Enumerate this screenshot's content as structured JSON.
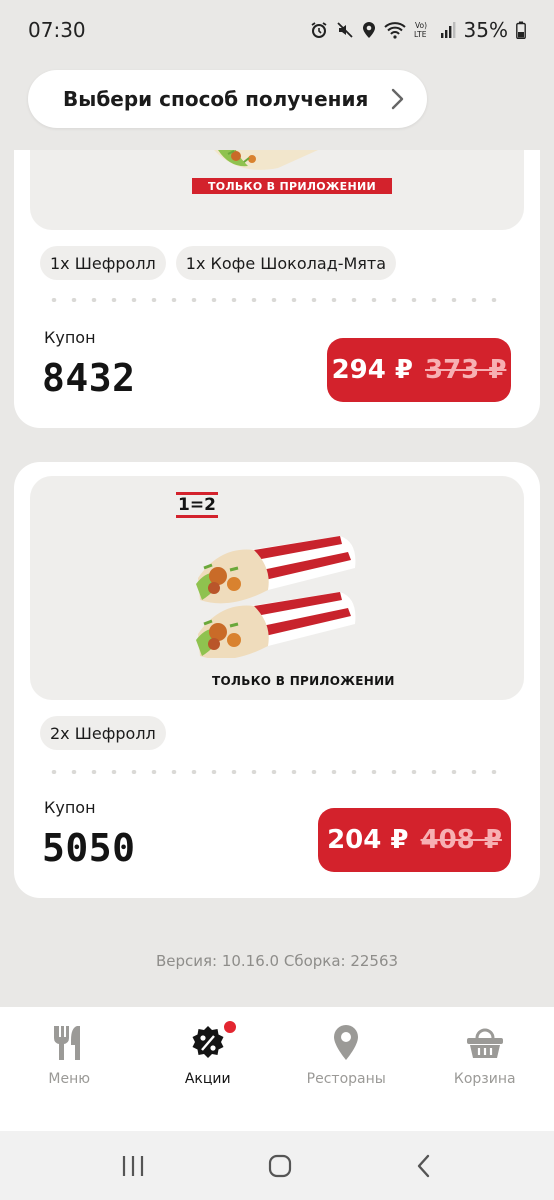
{
  "status_bar": {
    "time": "07:30",
    "battery": "35%",
    "icons": [
      "alarm-icon",
      "mute-icon",
      "location-icon",
      "wifi-icon",
      "volte-icon",
      "signal-icon",
      "battery-icon"
    ]
  },
  "delivery": {
    "label": "Выбери способ получения"
  },
  "offers": [
    {
      "promo_text": "ТОЛЬКО В ПРИЛОЖЕНИИ",
      "items": [
        "1х Шефролл",
        "1х Кофе Шоколад-Мята"
      ],
      "coupon_label": "Купон",
      "coupon_code": "8432",
      "price": "294 ₽",
      "old_price": "373 ₽"
    },
    {
      "badge": "1=2",
      "promo_text": "ТОЛЬКО В ПРИЛОЖЕНИИ",
      "items": [
        "2х Шефролл"
      ],
      "coupon_label": "Купон",
      "coupon_code": "5050",
      "price": "204 ₽",
      "old_price": "408 ₽"
    }
  ],
  "version": "Версия: 10.16.0 Сборка: 22563",
  "nav": {
    "items": [
      {
        "label": "Меню",
        "icon": "fork-knife-icon",
        "active": false
      },
      {
        "label": "Акции",
        "icon": "discount-badge-icon",
        "active": true
      },
      {
        "label": "Рестораны",
        "icon": "location-pin-icon",
        "active": false
      },
      {
        "label": "Корзина",
        "icon": "basket-icon",
        "active": false
      }
    ]
  },
  "colors": {
    "accent": "#d3222c",
    "background": "#e9e8e6",
    "card": "#ffffff",
    "chip": "#efeeec"
  }
}
